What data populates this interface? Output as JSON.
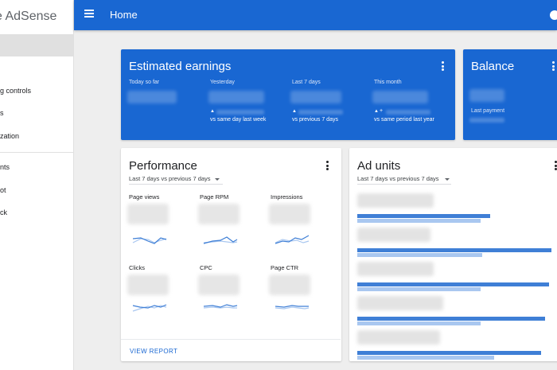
{
  "sidebar": {
    "brand": "e AdSense",
    "items": [
      "g controls",
      "s",
      "zation",
      "nts",
      "ot",
      "ck"
    ]
  },
  "topbar": {
    "title": "Home"
  },
  "earnings": {
    "title": "Estimated earnings",
    "columns": [
      {
        "label": "Today so far",
        "comparison": ""
      },
      {
        "label": "Yesterday",
        "comparison": "vs same day last week"
      },
      {
        "label": "Last 7 days",
        "comparison": "vs previous 7 days"
      },
      {
        "label": "This month",
        "comparison": "vs same period last year"
      }
    ],
    "up_arrow": "▲",
    "plus": "+"
  },
  "balance": {
    "title": "Balance",
    "last_payment": "Last payment"
  },
  "performance": {
    "title": "Performance",
    "range": "Last 7 days vs previous 7 days",
    "metrics": [
      "Page views",
      "Page RPM",
      "Impressions",
      "Clicks",
      "CPC",
      "Page CTR"
    ],
    "view_report": "VIEW REPORT"
  },
  "ad_units": {
    "title": "Ad units",
    "range": "Last 7 days vs previous 7 days",
    "rows": [
      {
        "current": 0.68,
        "previous": 0.63
      },
      {
        "current": 0.99,
        "previous": 0.64
      },
      {
        "current": 0.98,
        "previous": 0.63
      },
      {
        "current": 0.96,
        "previous": 0.63
      },
      {
        "current": 0.94,
        "previous": 0.7
      }
    ]
  },
  "colors": {
    "primary": "#1967d2",
    "bar_current": "#3f7fd6",
    "bar_previous": "#a9c7f0"
  }
}
